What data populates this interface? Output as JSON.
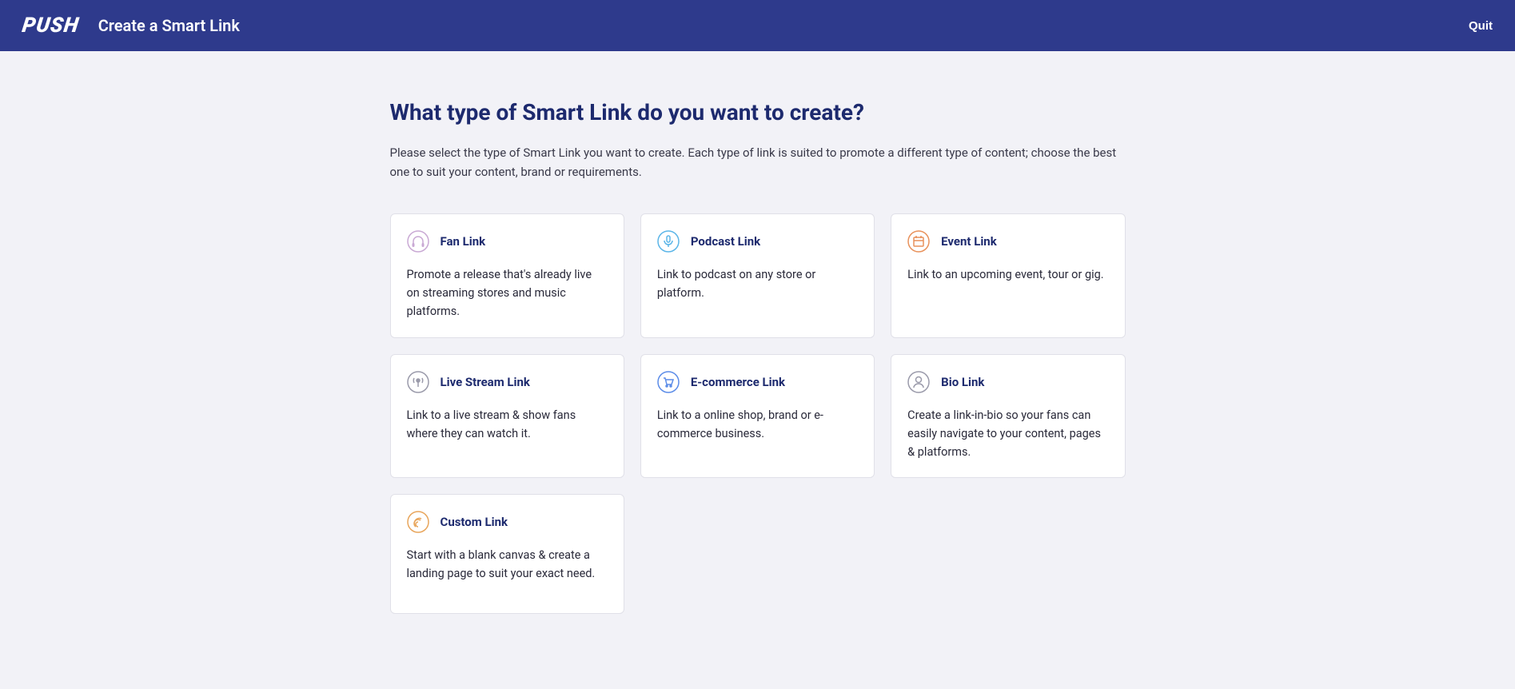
{
  "header": {
    "logo": "PUSH",
    "title": "Create a Smart Link",
    "quit": "Quit"
  },
  "main": {
    "heading": "What type of Smart Link do you want to create?",
    "description": "Please select the type of Smart Link you want to create. Each type of link is suited to promote a different type of content; choose the best one to suit your content, brand or requirements.",
    "cards": [
      {
        "icon": "headphones-icon",
        "title": "Fan Link",
        "description": "Promote a release that's already live on streaming stores and music platforms.",
        "iconColor": "#c9a9d4"
      },
      {
        "icon": "microphone-icon",
        "title": "Podcast Link",
        "description": "Link to podcast on any store or platform.",
        "iconColor": "#5bb5e8"
      },
      {
        "icon": "calendar-icon",
        "title": "Event Link",
        "description": "Link to an upcoming event, tour or gig.",
        "iconColor": "#e8915b"
      },
      {
        "icon": "stream-icon",
        "title": "Live Stream Link",
        "description": "Link to a live stream & show fans where they can watch it.",
        "iconColor": "#9a9aaa"
      },
      {
        "icon": "cart-icon",
        "title": "E-commerce Link",
        "description": "Link to a online shop, brand or e-commerce business.",
        "iconColor": "#5b8ce8"
      },
      {
        "icon": "person-icon",
        "title": "Bio Link",
        "description": "Create a link-in-bio so your fans can easily navigate to your content, pages & platforms.",
        "iconColor": "#9a9aaa"
      },
      {
        "icon": "fingerprint-icon",
        "title": "Custom Link",
        "description": "Start with a blank canvas & create a landing page to suit your exact need.",
        "iconColor": "#e8a55b"
      }
    ]
  }
}
